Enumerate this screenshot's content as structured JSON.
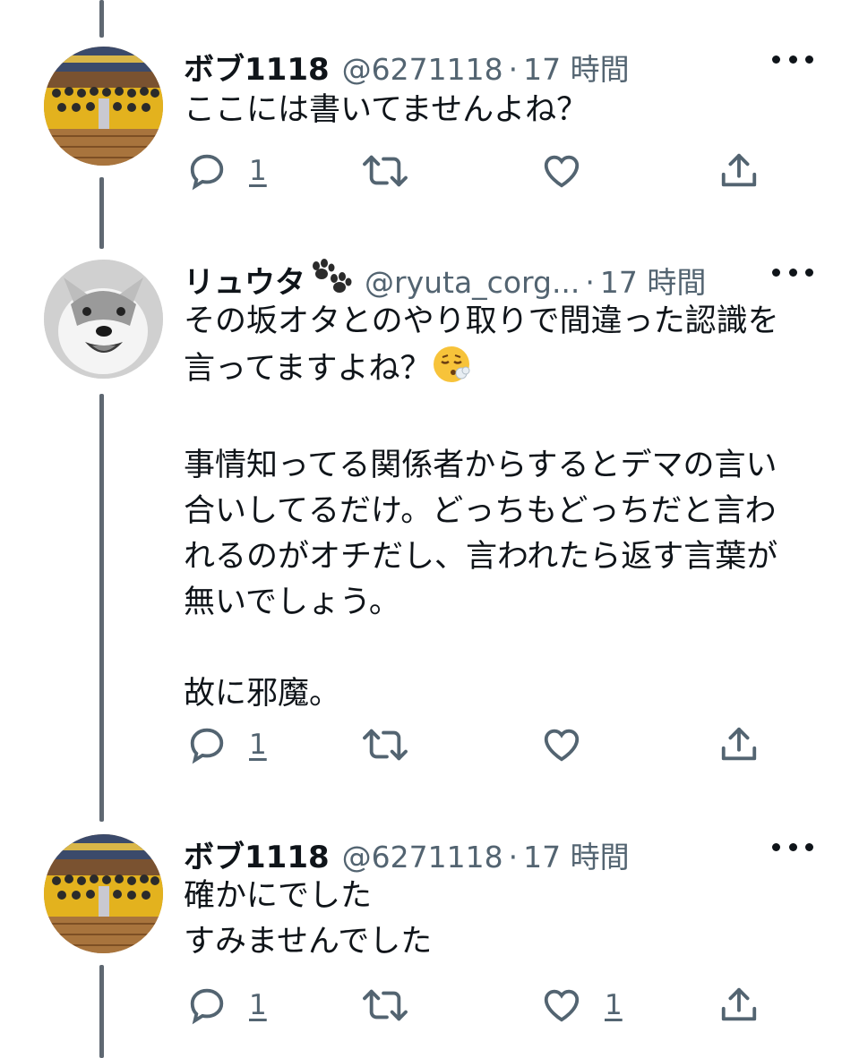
{
  "tweets": [
    {
      "name": "ボブ1118",
      "handle": "@6271118",
      "dot": "·",
      "time": "17 時間",
      "text": "ここには書いてませんよね？",
      "reply_count": "1",
      "retweet_count": "",
      "like_count": ""
    },
    {
      "name": "リュウタ",
      "handle": "@ryuta_corg...",
      "dot": "·",
      "time": "17 時間",
      "text": "その坂オタとのやり取りで間違った認識を\n言ってますよね？",
      "text2": "事情知ってる関係者からするとデマの言い\n合いしてるだけ。どっちもどっちだと言わ\nれるのがオチだし、言われたら返す言葉が\n無いでしょう。",
      "text3": "故に邪魔。",
      "reply_count": "1",
      "retweet_count": "",
      "like_count": ""
    },
    {
      "name": "ボブ1118",
      "handle": "@6271118",
      "dot": "·",
      "time": "17 時間",
      "text": "確かにでした\nすみませんでした",
      "reply_count": "1",
      "retweet_count": "",
      "like_count": "1"
    }
  ],
  "icons": [
    "reply-icon",
    "retweet-icon",
    "like-icon",
    "share-icon",
    "more-icon",
    "paw-emoji",
    "relieved-sweat-emoji"
  ],
  "colors": {
    "text": "#0f1419",
    "secondary": "#536471",
    "thread_line": "#5f6872"
  }
}
